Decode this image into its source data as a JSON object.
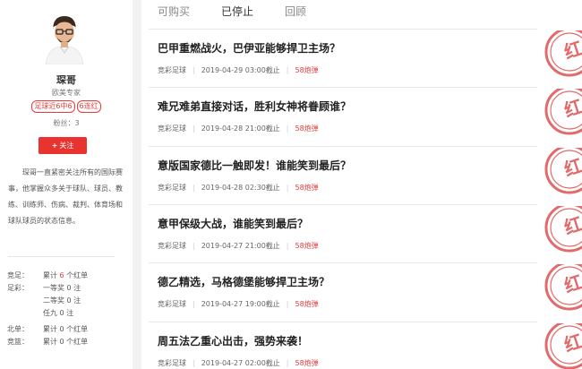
{
  "colors": {
    "accent": "#e8332f",
    "stamp": "#e36a6a"
  },
  "profile": {
    "name": "琛哥",
    "title": "欧美专家",
    "badges": [
      "足球近6中6",
      "6连红"
    ],
    "fans": "粉丝：3",
    "follow_label": "关注",
    "follow_icon": "plus-icon",
    "bio": "琛哥一直紧密关注所有的国际赛事，他掌握众多关于球队、球员、教练、训练师、伤病、裁判、体育场和球队球员的状态信息。",
    "stats": [
      {
        "category": "竞足：",
        "prefix": "累计 ",
        "count": "6",
        "suffix": " 个红单",
        "highlight": true
      },
      {
        "category": "足彩：",
        "prefix": "一等奖 ",
        "count": "0",
        "suffix": " 注",
        "highlight": false
      },
      {
        "category": "",
        "prefix": "二等奖 ",
        "count": "0",
        "suffix": " 注",
        "highlight": false
      },
      {
        "category": "",
        "prefix": "任九 ",
        "count": "0",
        "suffix": " 注",
        "highlight": false
      },
      {
        "category": "北单：",
        "prefix": "累计 ",
        "count": "0",
        "suffix": " 个红单",
        "highlight": false
      },
      {
        "category": "竞篮：",
        "prefix": "累计 ",
        "count": "0",
        "suffix": " 个红单",
        "highlight": false
      }
    ]
  },
  "tabs": [
    {
      "label": "可购买",
      "active": false
    },
    {
      "label": "已停止",
      "active": true
    },
    {
      "label": "回顾",
      "active": false
    }
  ],
  "articles": [
    {
      "title": "巴甲重燃战火，巴伊亚能够捍卫主场？",
      "category": "竞彩足球",
      "time": "2019-04-29 03:00截止",
      "price": "58炮弹",
      "stamp": "红"
    },
    {
      "title": "难兄难弟直接对话，胜利女神将眷顾谁？",
      "category": "竞彩足球",
      "time": "2019-04-28 21:00截止",
      "price": "58炮弹",
      "stamp": "红"
    },
    {
      "title": "意版国家德比一触即发！谁能笑到最后？",
      "category": "竞彩足球",
      "time": "2019-04-28 02:30截止",
      "price": "58炮弹",
      "stamp": "红"
    },
    {
      "title": "意甲保级大战，谁能笑到最后？",
      "category": "竞彩足球",
      "time": "2019-04-27 21:00截止",
      "price": "58炮弹",
      "stamp": "红"
    },
    {
      "title": "德乙精选，马格德堡能够捍卫主场？",
      "category": "竞彩足球",
      "time": "2019-04-27 19:00截止",
      "price": "58炮弹",
      "stamp": "红"
    },
    {
      "title": "周五法乙重心出击，强势来袭！",
      "category": "竞彩足球",
      "time": "2019-04-27 02:00截止",
      "price": "58炮弹",
      "stamp": "红"
    }
  ]
}
